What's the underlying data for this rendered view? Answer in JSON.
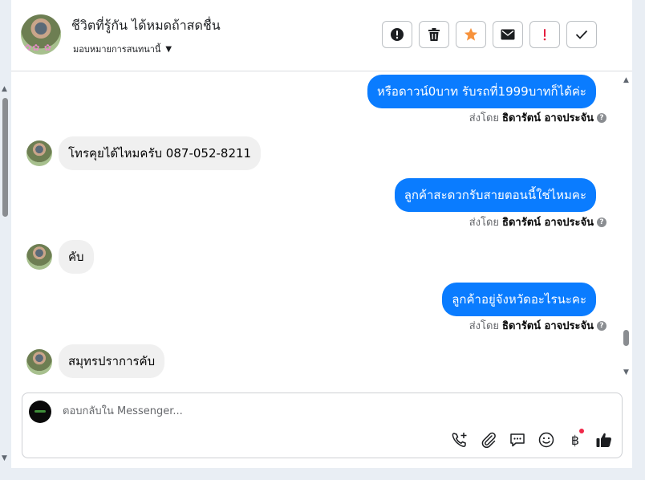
{
  "header": {
    "contact_name": "ชีวิตที่รู้กัน ได้หมดถ้าสดชื่น",
    "assign_label": "มอบหมายการสนทนานี้",
    "actions": [
      {
        "name": "report-button",
        "icon": "exclamation-circle-icon"
      },
      {
        "name": "delete-button",
        "icon": "trash-icon"
      },
      {
        "name": "star-button",
        "icon": "star-icon"
      },
      {
        "name": "mark-unread-button",
        "icon": "envelope-icon"
      },
      {
        "name": "follow-up-button",
        "icon": "exclamation-icon"
      },
      {
        "name": "mark-done-button",
        "icon": "check-icon"
      }
    ]
  },
  "thread": {
    "messages": [
      {
        "direction": "out",
        "text": "หรือดาวน์0บาท รับรถที่1999บาทก็ได้ค่ะ"
      },
      {
        "direction": "in",
        "text": "โทรคุยได้ไหมครับ 087-052-8211"
      },
      {
        "direction": "out",
        "text": "ลูกค้าสะดวกรับสายตอนนี้ใช่ไหมคะ"
      },
      {
        "direction": "in",
        "text": "คับ"
      },
      {
        "direction": "out",
        "text": "ลูกค้าอยู่จังหวัดอะไรนะคะ"
      },
      {
        "direction": "in",
        "text": "สมุทรปราการคับ"
      }
    ],
    "sent_by_prefix": "ส่งโดย",
    "sent_by_name": "ธิดารัตน์ อาจประจัน"
  },
  "composer": {
    "placeholder": "ตอบกลับใน Messenger...",
    "currency_symbol": "฿",
    "tools": [
      "add-call-icon",
      "paperclip-icon",
      "saved-reply-icon",
      "emoji-icon",
      "baht-icon",
      "thumbs-up-icon"
    ]
  },
  "colors": {
    "outgoing_bubble": "#0a7cff",
    "incoming_bubble": "#f0f0f0",
    "star": "#f7923b",
    "alert": "#e41e3f"
  }
}
